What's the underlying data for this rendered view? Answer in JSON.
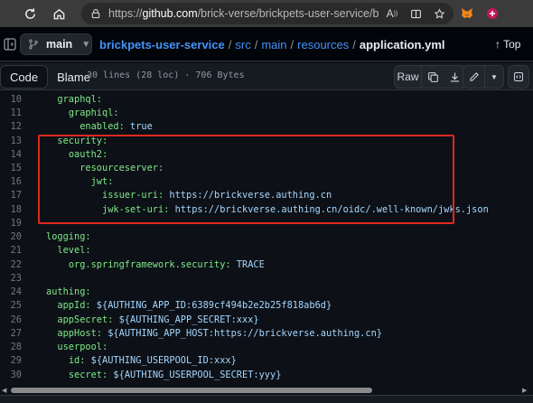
{
  "browser": {
    "url_prefix": "https://",
    "url_host": "github.com",
    "url_path": "/brick-verse/brickpets-user-service/blob/...",
    "icons": [
      "refresh-icon",
      "home-icon",
      "lock-icon",
      "read-aloud-icon",
      "split-screen-icon",
      "favorite-icon",
      "metamask-icon",
      "extension-icon"
    ]
  },
  "header": {
    "branch": "main",
    "breadcrumb": {
      "repo": "brickpets-user-service",
      "dirs": [
        "src",
        "main",
        "resources"
      ],
      "file": "application.yml"
    },
    "top_label": "Top"
  },
  "toolbar": {
    "code_tab": "Code",
    "blame_tab": "Blame",
    "meta": "30 lines (28 loc) · 706 Bytes",
    "raw_label": "Raw"
  },
  "code_lines": [
    {
      "n": "10",
      "indent": "  ",
      "key": "graphql:",
      "val": ""
    },
    {
      "n": "11",
      "indent": "    ",
      "key": "graphiql:",
      "val": ""
    },
    {
      "n": "12",
      "indent": "      ",
      "key": "enabled:",
      "val": " true"
    },
    {
      "n": "13",
      "indent": "  ",
      "key": "security:",
      "val": ""
    },
    {
      "n": "14",
      "indent": "    ",
      "key": "oauth2:",
      "val": ""
    },
    {
      "n": "15",
      "indent": "      ",
      "key": "resourceserver:",
      "val": ""
    },
    {
      "n": "16",
      "indent": "        ",
      "key": "jwt:",
      "val": ""
    },
    {
      "n": "17",
      "indent": "          ",
      "key": "issuer-uri:",
      "val": " https://brickverse.authing.cn"
    },
    {
      "n": "18",
      "indent": "          ",
      "key": "jwk-set-uri:",
      "val": " https://brickverse.authing.cn/oidc/.well-known/jwks.json"
    },
    {
      "n": "19",
      "indent": "",
      "key": "",
      "val": ""
    },
    {
      "n": "20",
      "indent": "",
      "key": "logging:",
      "val": ""
    },
    {
      "n": "21",
      "indent": "  ",
      "key": "level:",
      "val": ""
    },
    {
      "n": "22",
      "indent": "    ",
      "key": "org.springframework.security:",
      "val": " TRACE"
    },
    {
      "n": "23",
      "indent": "",
      "key": "",
      "val": ""
    },
    {
      "n": "24",
      "indent": "",
      "key": "authing:",
      "val": ""
    },
    {
      "n": "25",
      "indent": "  ",
      "key": "appId:",
      "val": " ${AUTHING_APP_ID:6389cf494b2e2b25f818ab6d}"
    },
    {
      "n": "26",
      "indent": "  ",
      "key": "appSecret:",
      "val": " ${AUTHING_APP_SECRET:xxx}"
    },
    {
      "n": "27",
      "indent": "  ",
      "key": "appHost:",
      "val": " ${AUTHING_APP_HOST:https://brickverse.authing.cn}"
    },
    {
      "n": "28",
      "indent": "  ",
      "key": "userpool:",
      "val": ""
    },
    {
      "n": "29",
      "indent": "    ",
      "key": "id:",
      "val": " ${AUTHING_USERPOOL_ID:xxx}"
    },
    {
      "n": "30",
      "indent": "    ",
      "key": "secret:",
      "val": " ${AUTHING_USERPOOL_SECRET:yyy}"
    }
  ],
  "colors": {
    "key": "#7ee787",
    "value": "#a5d6ff",
    "highlight_box": "#e0281e",
    "link": "#4493f8"
  }
}
